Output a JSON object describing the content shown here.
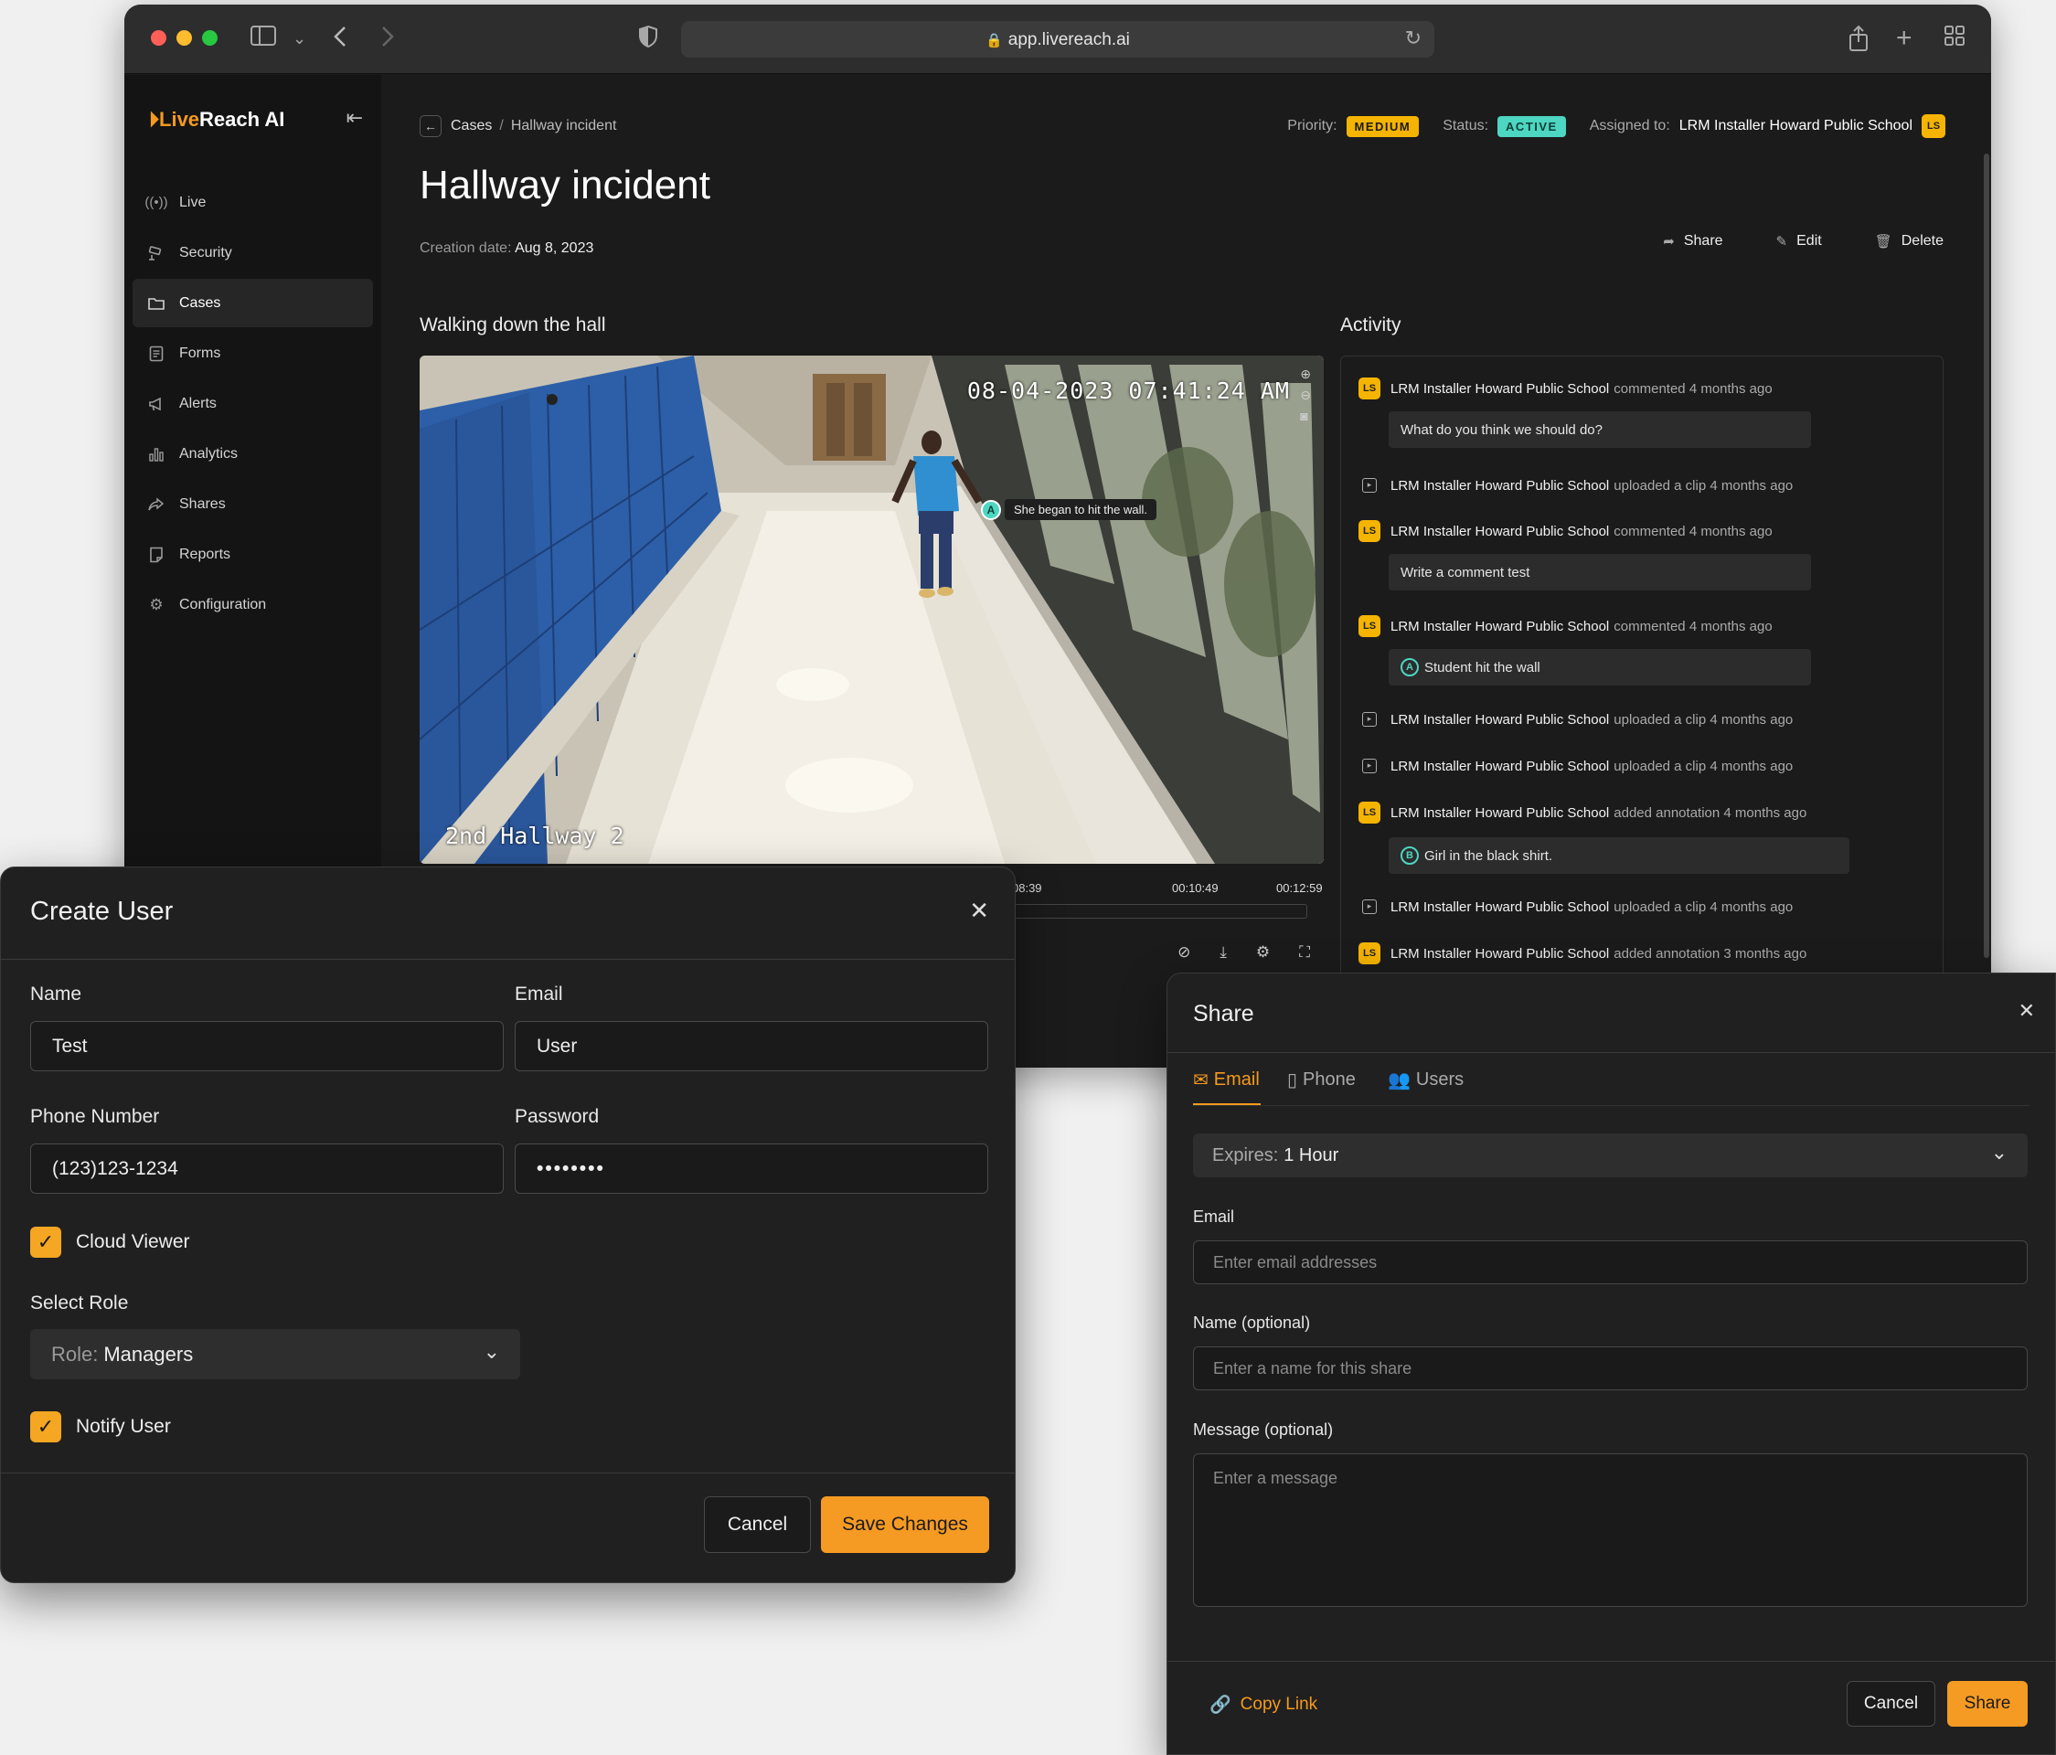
{
  "browser": {
    "url": "app.livereach.ai",
    "traffic_light_colors": [
      "#ff5f57",
      "#febc2e",
      "#28c840"
    ]
  },
  "sidebar": {
    "brand_live": "Live",
    "brand_rest": "Reach AI",
    "items": [
      {
        "label": "Live",
        "icon": "live-icon"
      },
      {
        "label": "Security",
        "icon": "security-camera-icon"
      },
      {
        "label": "Cases",
        "icon": "folder-icon",
        "active": true
      },
      {
        "label": "Forms",
        "icon": "form-icon"
      },
      {
        "label": "Alerts",
        "icon": "megaphone-icon"
      },
      {
        "label": "Analytics",
        "icon": "bar-chart-icon"
      },
      {
        "label": "Shares",
        "icon": "share-icon"
      },
      {
        "label": "Reports",
        "icon": "report-icon"
      },
      {
        "label": "Configuration",
        "icon": "gear-icon"
      }
    ]
  },
  "case": {
    "breadcrumb_parent": "Cases",
    "breadcrumb_separator": "/",
    "breadcrumb_current": "Hallway incident",
    "priority_label": "Priority:",
    "priority": "MEDIUM",
    "status_label": "Status:",
    "status": "ACTIVE",
    "assigned_label": "Assigned to:",
    "assigned_to": "LRM Installer Howard Public School",
    "assigned_initials": "LS",
    "title": "Hallway incident",
    "creation_label": "Creation date:",
    "creation_date": "Aug 8, 2023",
    "actions": {
      "share": "Share",
      "edit": "Edit",
      "delete": "Delete"
    },
    "clip_title": "Walking down the hall",
    "activity_title": "Activity"
  },
  "video": {
    "timestamp": "08-04-2023 07:41:24 AM",
    "camera_label": "2nd Hallway 2",
    "annotation_marker": "A",
    "annotation_text": "She began to hit the wall.",
    "ticks": [
      "08:39",
      "00:10:49",
      "00:12:59"
    ]
  },
  "activity": [
    {
      "type": "comment",
      "user": "LRM Installer Howard Public School",
      "action": "commented 4 months ago",
      "text": "What do you think we should do?"
    },
    {
      "type": "clip",
      "user": "LRM Installer Howard Public School",
      "action": "uploaded a clip 4 months ago"
    },
    {
      "type": "comment",
      "user": "LRM Installer Howard Public School",
      "action": "commented 4 months ago",
      "text": "Write a comment test"
    },
    {
      "type": "comment",
      "user": "LRM Installer Howard Public School",
      "action": "commented 4 months ago",
      "text": "Student hit the wall",
      "marker": "A"
    },
    {
      "type": "clip",
      "user": "LRM Installer Howard Public School",
      "action": "uploaded a clip 4 months ago"
    },
    {
      "type": "clip",
      "user": "LRM Installer Howard Public School",
      "action": "uploaded a clip 4 months ago"
    },
    {
      "type": "annotation",
      "user": "LRM Installer Howard Public School",
      "action": "added annotation 4 months ago",
      "text": "Girl in the black shirt.",
      "marker": "B"
    },
    {
      "type": "clip",
      "user": "LRM Installer Howard Public School",
      "action": "uploaded a clip 4 months ago"
    },
    {
      "type": "annotation",
      "user": "LRM Installer Howard Public School",
      "action": "added annotation 3 months ago"
    }
  ],
  "create_user": {
    "title": "Create User",
    "name_label": "Name",
    "name_value": "Test",
    "email_label": "Email",
    "email_value": "User",
    "phone_label": "Phone Number",
    "phone_value": "(123)123-1234",
    "password_label": "Password",
    "password_value": "••••••••",
    "cloud_viewer_label": "Cloud Viewer",
    "cloud_viewer_checked": true,
    "role_section_label": "Select Role",
    "role_prefix": "Role:",
    "role_value": "Managers",
    "notify_label": "Notify User",
    "notify_checked": true,
    "cancel_label": "Cancel",
    "save_label": "Save Changes"
  },
  "share": {
    "title": "Share",
    "tabs": [
      "Email",
      "Phone",
      "Users"
    ],
    "active_tab": "Email",
    "expires_prefix": "Expires:",
    "expires_value": "1 Hour",
    "email_label": "Email",
    "email_placeholder": "Enter email addresses",
    "name_label": "Name (optional)",
    "name_placeholder": "Enter a name for this share",
    "message_label": "Message (optional)",
    "message_placeholder": "Enter a message",
    "copy_link_label": "Copy Link",
    "cancel_label": "Cancel",
    "share_label": "Share"
  },
  "colors": {
    "accent": "#f59a1c",
    "priority_badge": "#f5b400",
    "status_badge": "#4dd6c1"
  }
}
